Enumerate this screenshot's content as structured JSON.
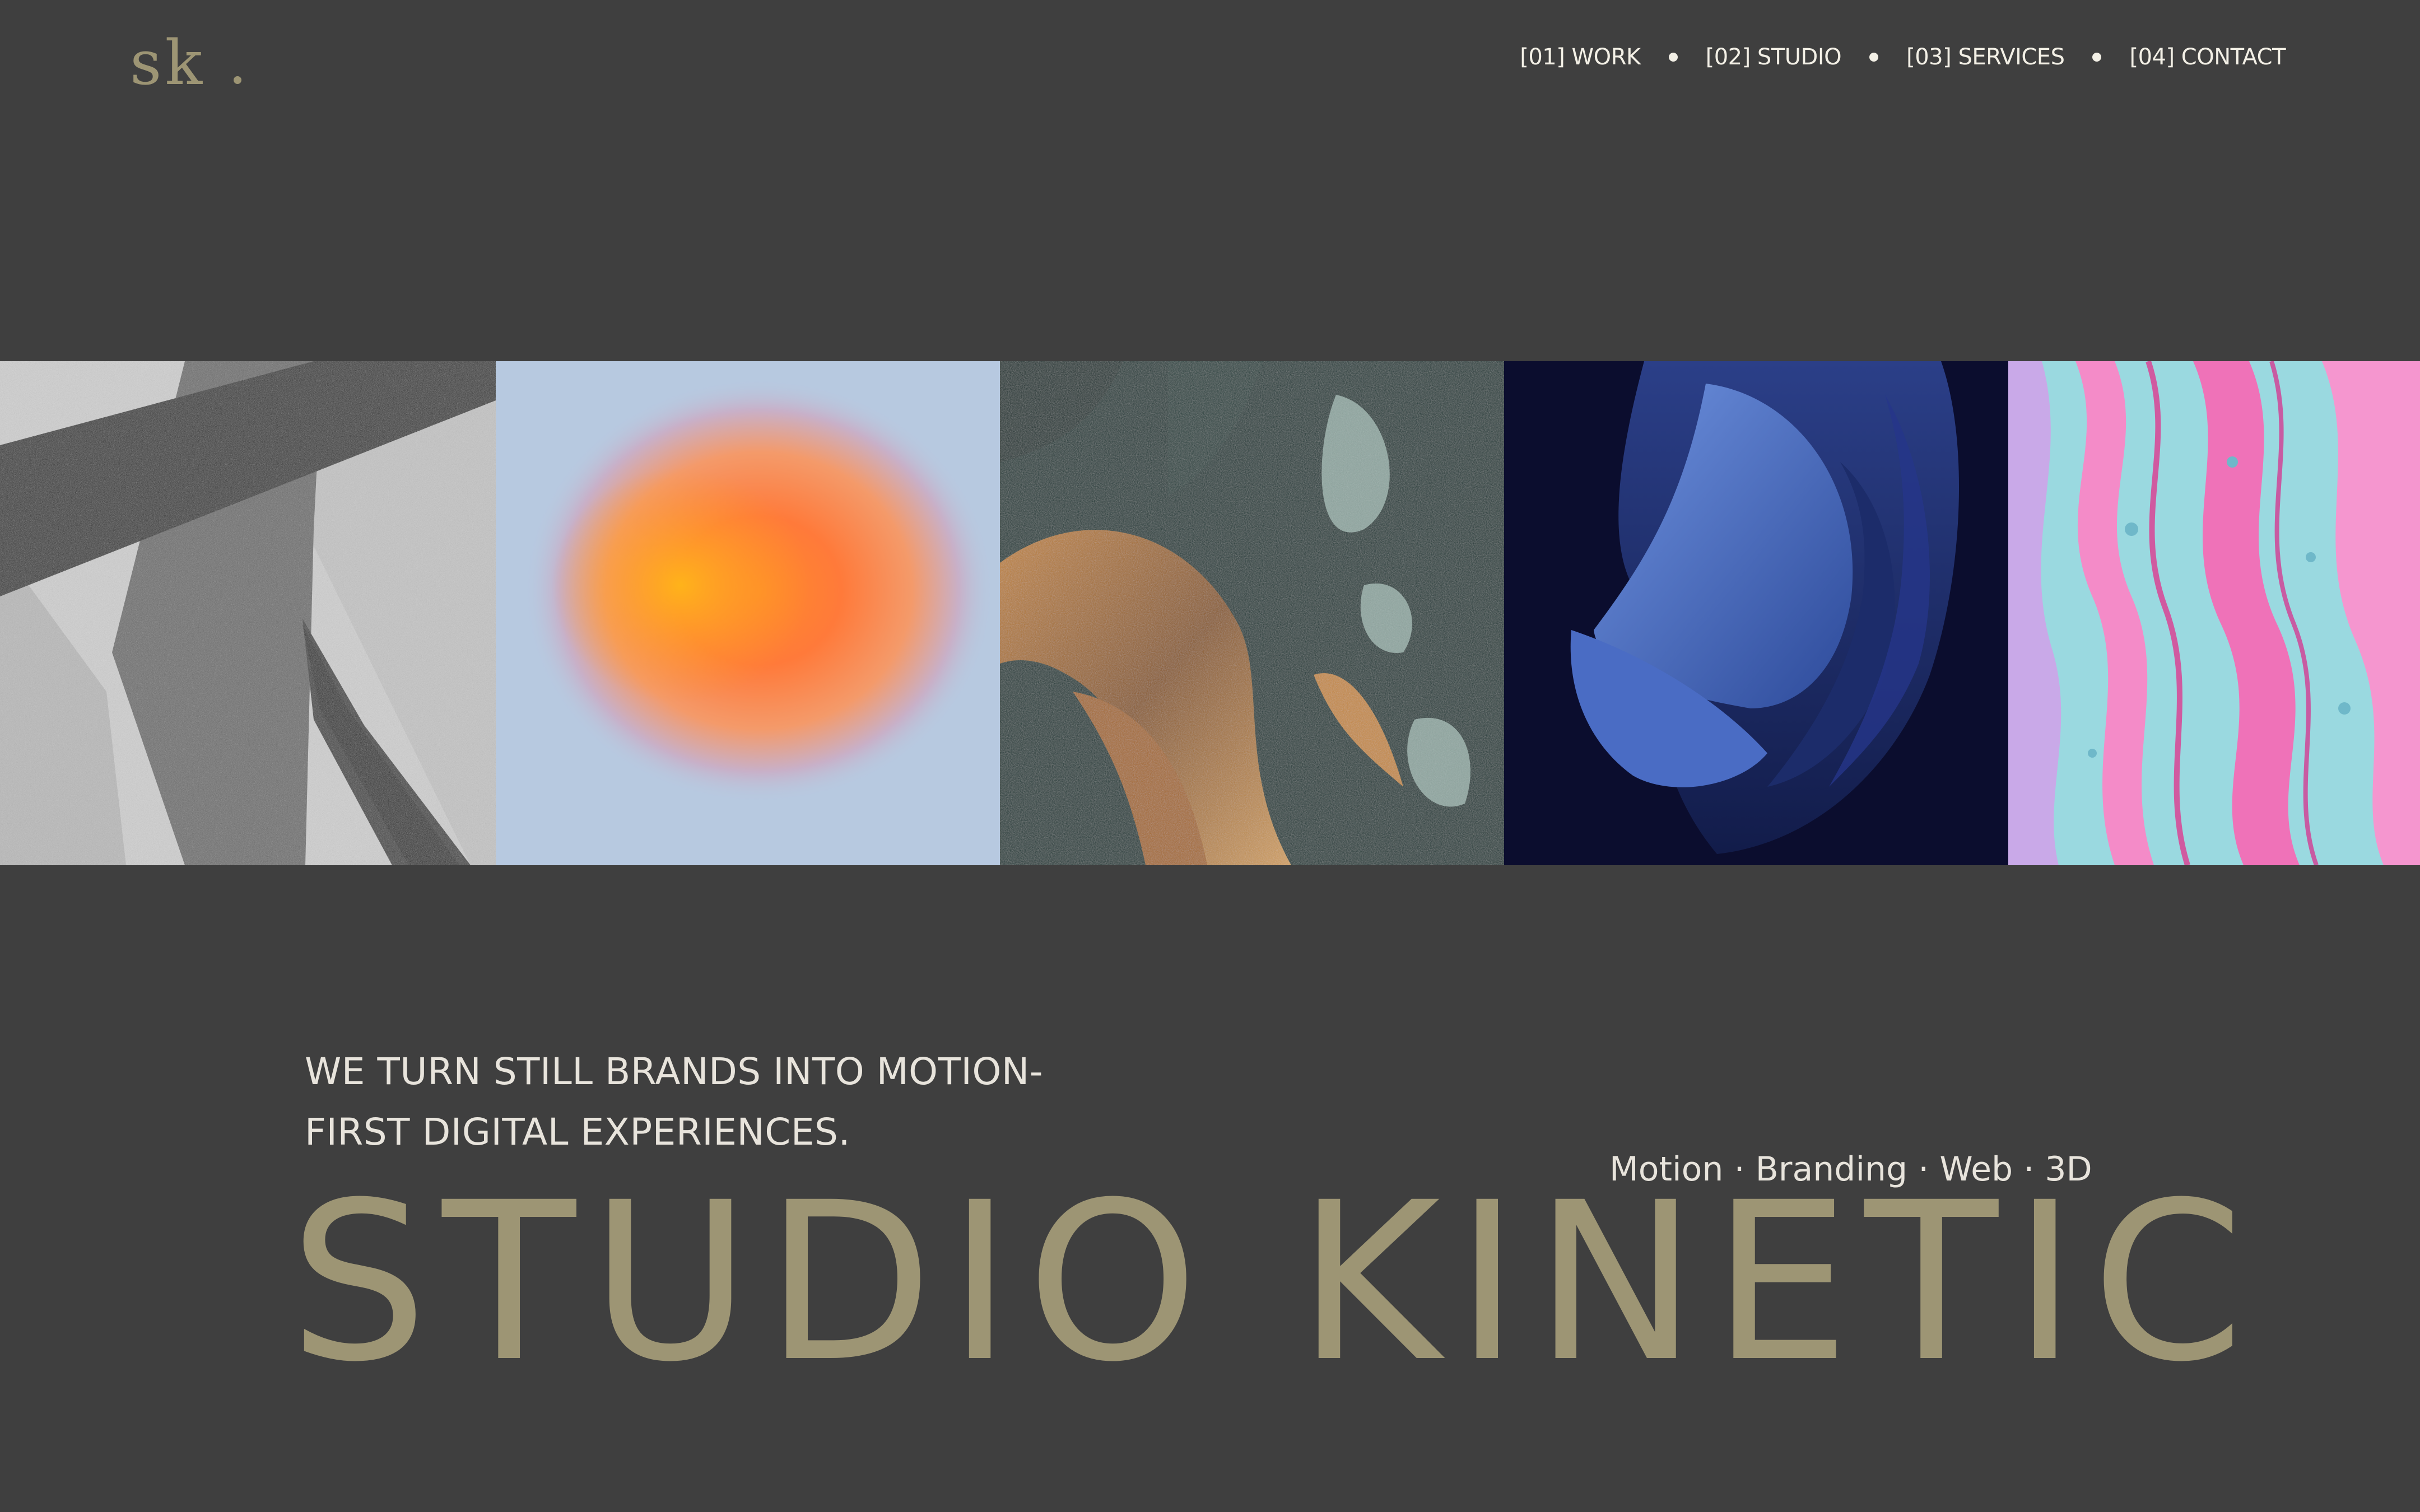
{
  "header": {
    "logo_text": "sk",
    "nav": [
      {
        "label": "[01] WORK"
      },
      {
        "label": "[02] STUDIO"
      },
      {
        "label": "[03] SERVICES"
      },
      {
        "label": "[04] CONTACT"
      }
    ]
  },
  "gallery": {
    "tiles": [
      {
        "name": "abstract-grey-shapes"
      },
      {
        "name": "orange-gradient-blur"
      },
      {
        "name": "teal-gold-sculpture"
      },
      {
        "name": "blue-folded-form"
      },
      {
        "name": "pink-teal-marble"
      }
    ]
  },
  "hero": {
    "tagline_line1": "WE TURN STILL BRANDS INTO MOTION-",
    "tagline_line2": "FIRST DIGITAL EXPERIENCES.",
    "services": "Motion · Branding · Web · 3D",
    "title": "STUDIO KINETIC"
  },
  "colors": {
    "background": "#3f3f3f",
    "accent": "#9d9574",
    "text": "#e8e4dc"
  }
}
